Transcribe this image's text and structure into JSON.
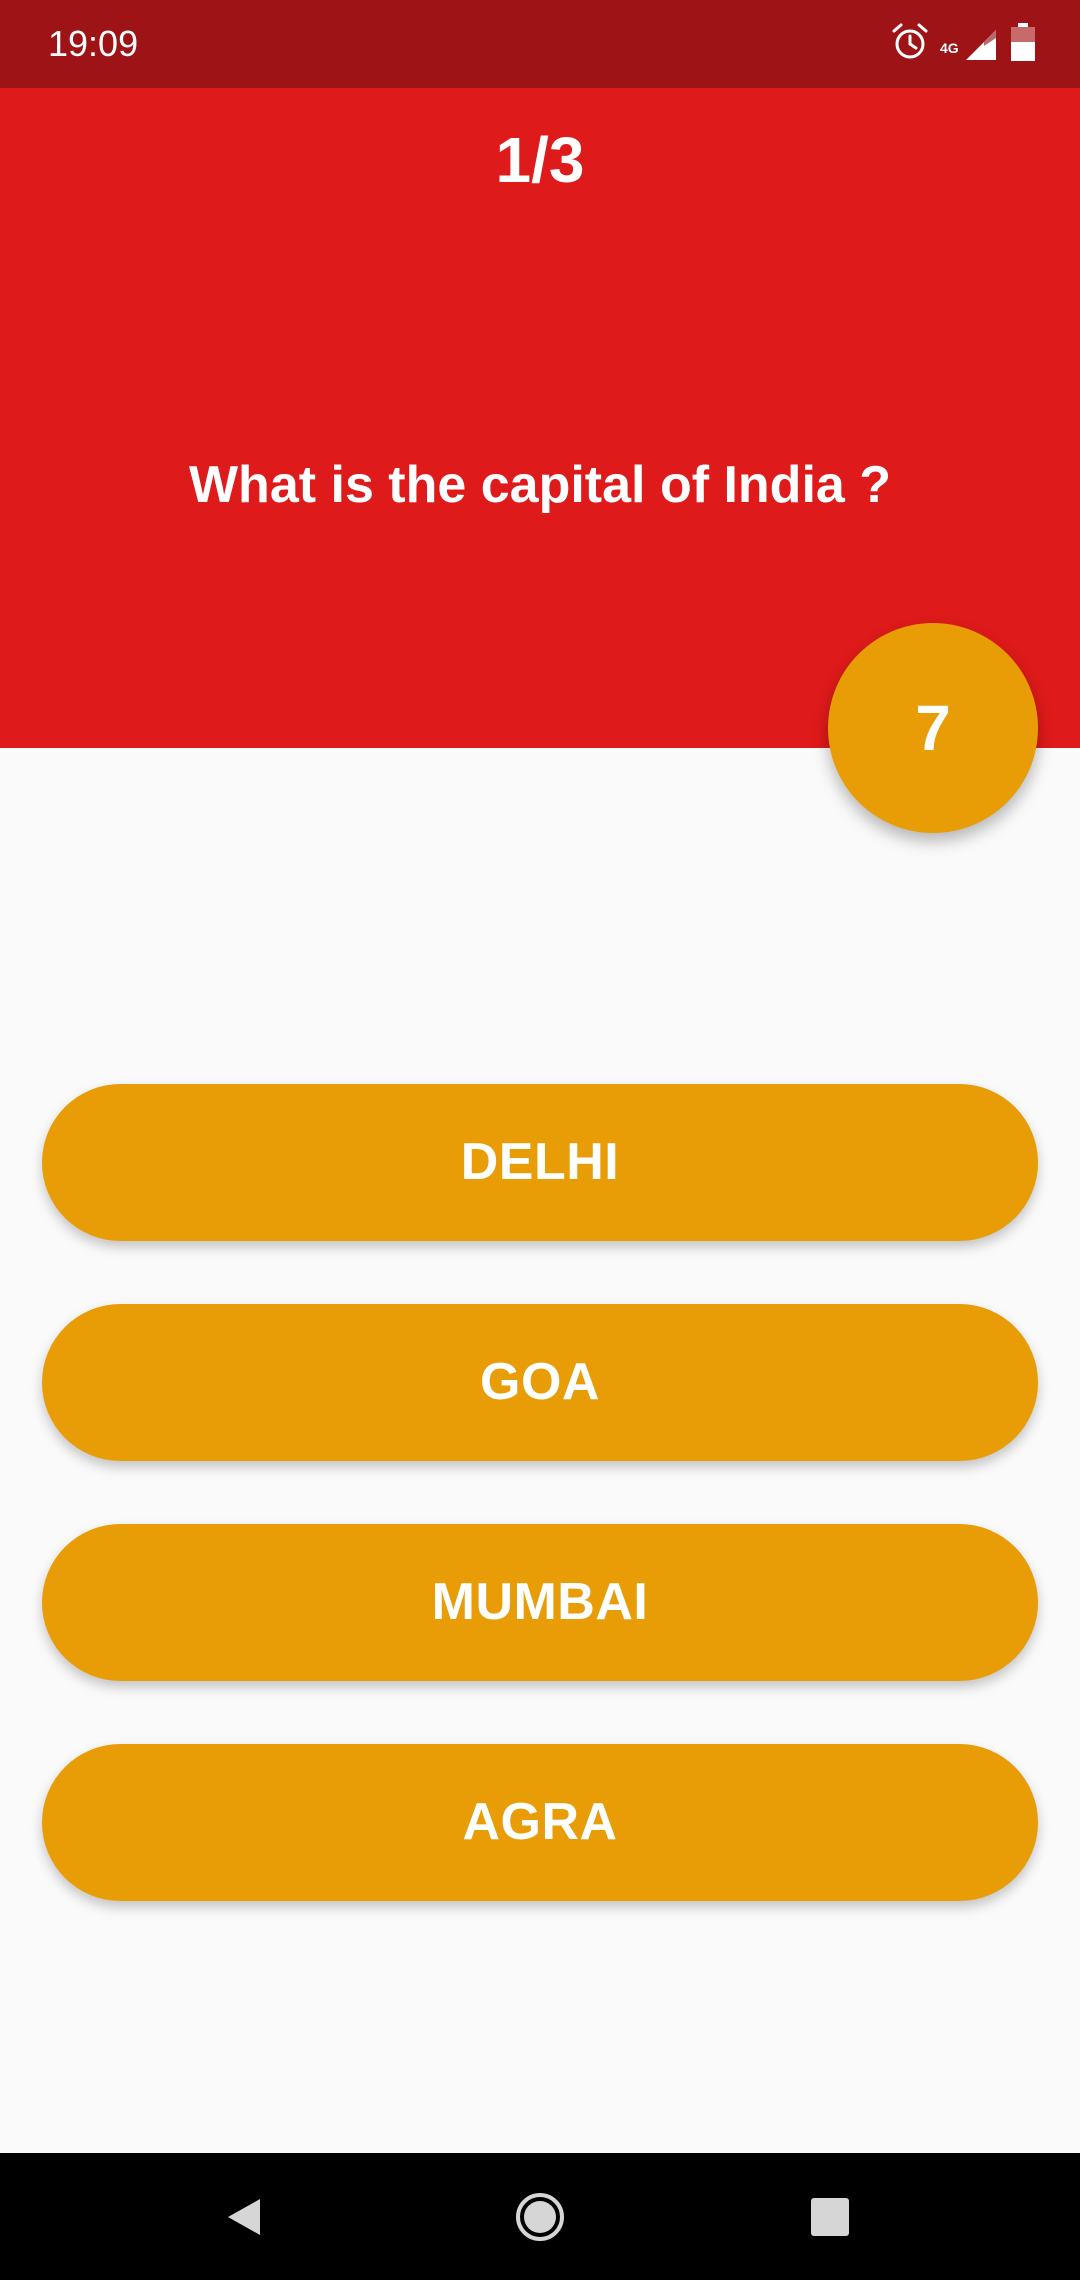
{
  "status_bar": {
    "time": "19:09",
    "icons": [
      "alarm-icon",
      "signal-4g-icon",
      "battery-icon"
    ],
    "network_label": "4G"
  },
  "quiz": {
    "progress": "1/3",
    "question": "What is the capital of India ?",
    "timer": "7",
    "answers": [
      "DELHI",
      "GOA",
      "MUMBAI",
      "AGRA"
    ]
  },
  "nav": {
    "buttons": [
      "back-icon",
      "home-icon",
      "recents-icon"
    ]
  },
  "colors": {
    "status_bar": "#9e1316",
    "header": "#df1a1a",
    "accent": "#e89c05",
    "background": "#fafafa"
  }
}
